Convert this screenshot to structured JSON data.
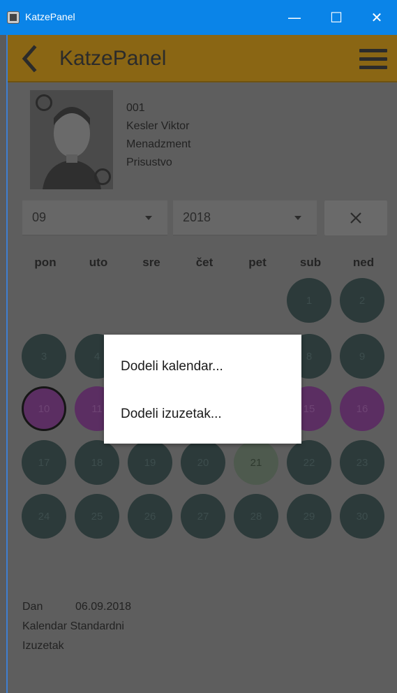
{
  "window": {
    "title": "KatzePanel",
    "minimize_glyph": "—",
    "maximize_glyph": "☐",
    "close_glyph": "✕"
  },
  "appbar": {
    "title": "KatzePanel",
    "back_icon": "chevron-left-icon",
    "menu_icon": "hamburger-menu-icon"
  },
  "employee": {
    "id": "001",
    "name": "Kesler Viktor",
    "department": "Menadzment",
    "status": "Prisustvo"
  },
  "filters": {
    "month": "09",
    "year": "2018",
    "clear_glyph": "✕"
  },
  "calendar": {
    "weekdays": [
      "pon",
      "uto",
      "sre",
      "čet",
      "pet",
      "sub",
      "ned"
    ],
    "days": [
      {
        "label": "1"
      },
      {
        "label": "2"
      },
      {
        "label": "3"
      },
      {
        "label": "4"
      },
      {
        "label": "8"
      },
      {
        "label": "9"
      },
      {
        "label": "10"
      },
      {
        "label": "11"
      },
      {
        "label": "15"
      },
      {
        "label": "16"
      },
      {
        "label": "17"
      },
      {
        "label": "18"
      },
      {
        "label": "19"
      },
      {
        "label": "20"
      },
      {
        "label": "21"
      },
      {
        "label": "22"
      },
      {
        "label": "23"
      },
      {
        "label": "24"
      },
      {
        "label": "25"
      },
      {
        "label": "26"
      },
      {
        "label": "27"
      },
      {
        "label": "28"
      },
      {
        "label": "29"
      },
      {
        "label": "30"
      }
    ],
    "colors": {
      "default_day": "#2c3a3a",
      "holiday_day": "#5b2e62",
      "today_day": "#4e5a4e"
    }
  },
  "context_menu": {
    "items": [
      "Dodeli kalendar...",
      "Dodeli izuzetak..."
    ]
  },
  "details": {
    "day_label": "Dan",
    "day_value": "06.09.2018",
    "calendar_label": "Kalendar",
    "calendar_value": "Standardni",
    "exception_label": "Izuzetak"
  }
}
